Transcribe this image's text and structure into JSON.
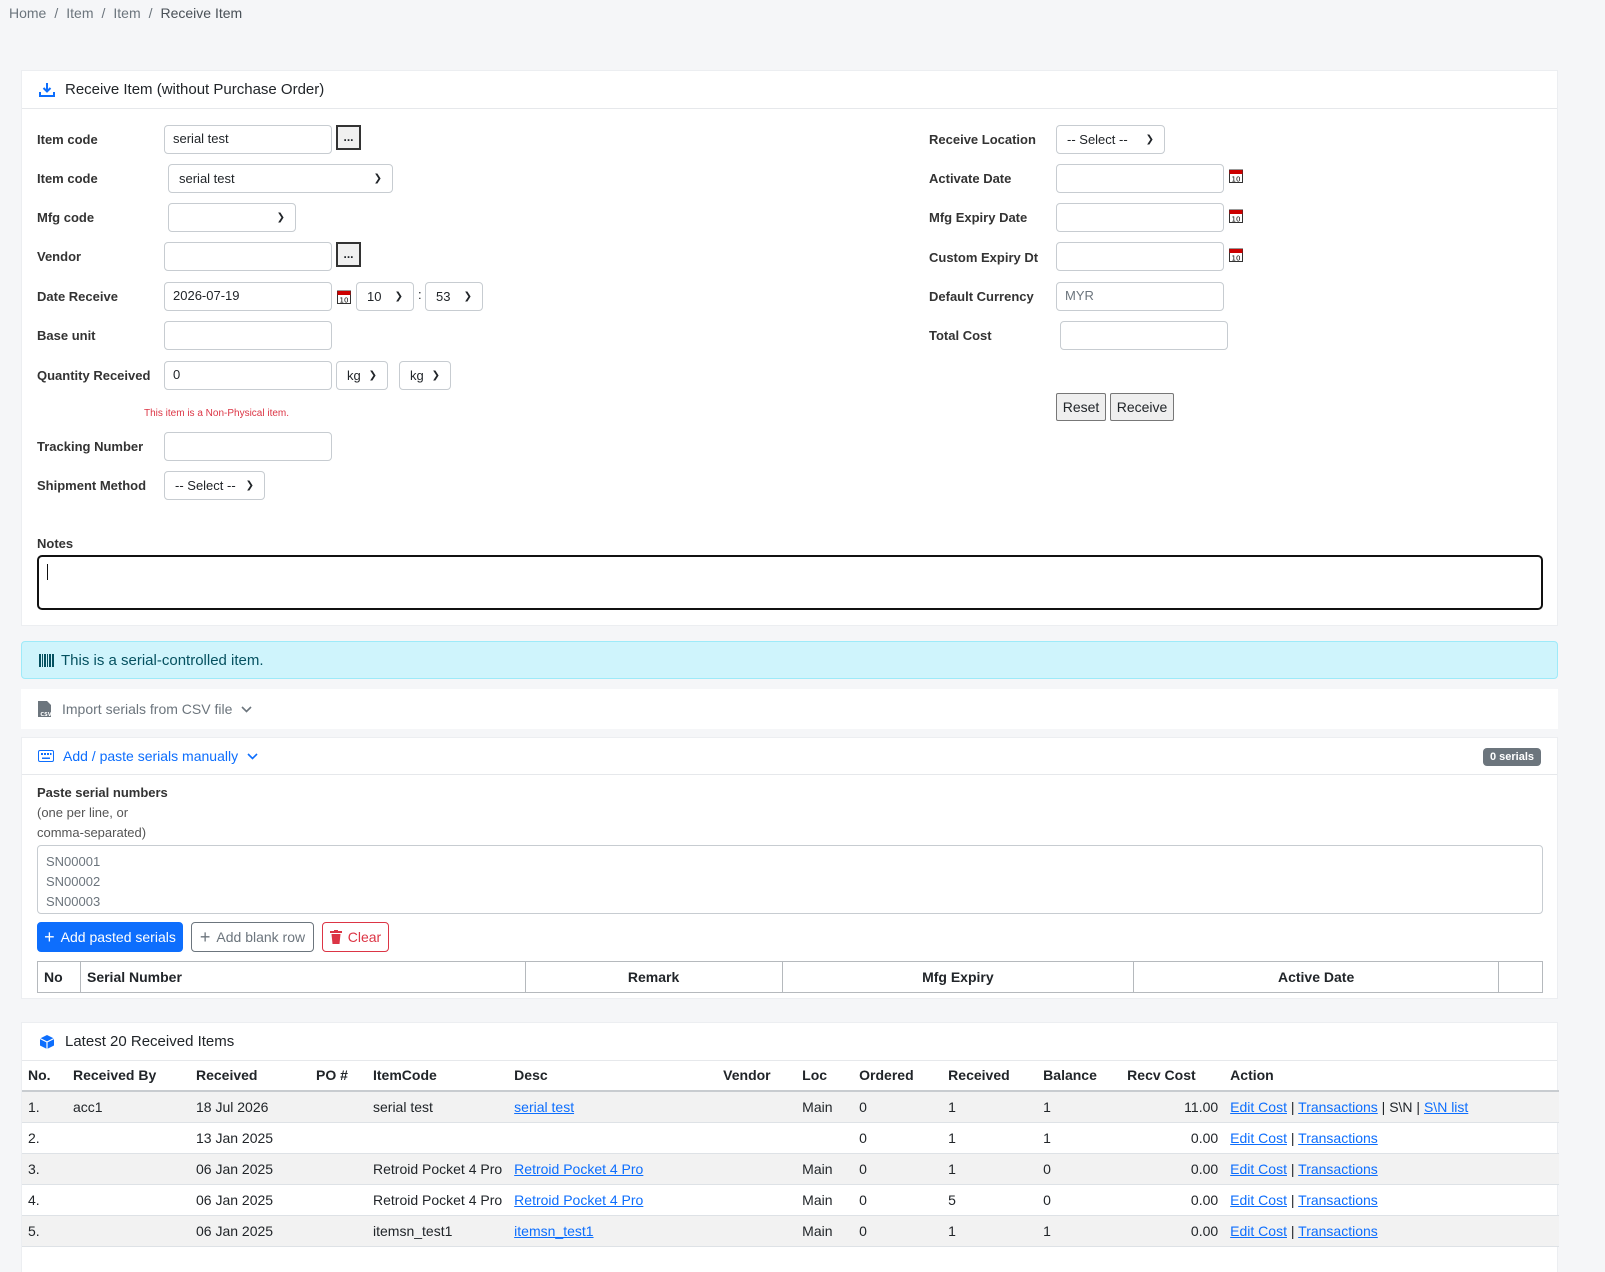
{
  "breadcrumb": {
    "home": "Home",
    "item1": "Item",
    "item2": "Item",
    "current": "Receive Item"
  },
  "receive_card": {
    "title": "Receive Item (without Purchase Order)",
    "item_code_label": "Item code",
    "item_code_value": "serial test",
    "item_code2_label": "Item code",
    "item_code2_value": "serial test",
    "mfg_code_label": "Mfg code",
    "vendor_label": "Vendor",
    "date_receive_label": "Date Receive",
    "date_receive_value": "2026-07-19",
    "hour": "10",
    "minute": "53",
    "time_sep": ":",
    "base_unit_label": "Base unit",
    "qty_label": "Quantity Received",
    "qty_value": "0",
    "unit1": "kg",
    "unit2": "kg",
    "non_physical_note": "This item is a Non-Physical item.",
    "tracking_label": "Tracking Number",
    "shipment_label": "Shipment Method",
    "shipment_value": "-- Select --",
    "receive_location_label": "Receive Location",
    "receive_location_value": "-- Select --",
    "activate_date_label": "Activate Date",
    "mfg_expiry_label": "Mfg Expiry Date",
    "custom_expiry_label": "Custom Expiry Dt",
    "default_currency_label": "Default Currency",
    "default_currency_placeholder": "MYR",
    "total_cost_label": "Total Cost",
    "reset_label": "Reset",
    "receive_label": "Receive",
    "notes_label": "Notes",
    "dots": "..."
  },
  "alert": {
    "text": "This is a serial-controlled item."
  },
  "import_csv": {
    "label": "Import serials from CSV file"
  },
  "manual": {
    "label": "Add / paste serials manually",
    "badge": "0 serials",
    "paste_label": "Paste serial numbers",
    "paste_hint_1": "(one per line, or",
    "paste_hint_2": "comma-separated)",
    "placeholder_line1": "SN00001",
    "placeholder_line2": "SN00002",
    "placeholder_line3": "SN00003",
    "add_pasted": "Add pasted serials",
    "add_blank": "Add blank row",
    "clear": "Clear",
    "columns": [
      "No",
      "Serial Number",
      "Remark",
      "Mfg Expiry",
      "Active Date"
    ]
  },
  "latest": {
    "title": "Latest 20 Received Items",
    "columns": [
      "No.",
      "Received By",
      "Received",
      "PO #",
      "ItemCode",
      "Desc",
      "Vendor",
      "Loc",
      "Ordered",
      "Received",
      "Balance",
      "Recv Cost",
      "Action"
    ],
    "rows": [
      {
        "no": "1.",
        "by": "acc1",
        "received": "18 Jul 2026",
        "po": "",
        "code": "serial test",
        "desc": "serial test",
        "vendor": "",
        "loc": "Main",
        "ordered": "0",
        "recv": "1",
        "balance": "1",
        "cost": "11.00",
        "edit": "Edit Cost",
        "trans": "Transactions",
        "sn": "S\\N",
        "snlist": "S\\N list"
      },
      {
        "no": "2.",
        "by": "",
        "received": "13 Jan 2025",
        "po": "",
        "code": "",
        "desc": "",
        "vendor": "",
        "loc": "",
        "ordered": "0",
        "recv": "1",
        "balance": "1",
        "cost": "0.00",
        "edit": "Edit Cost",
        "trans": "Transactions"
      },
      {
        "no": "3.",
        "by": "",
        "received": "06 Jan 2025",
        "po": "",
        "code": "Retroid Pocket 4 Pro",
        "desc": "Retroid Pocket 4 Pro",
        "vendor": "",
        "loc": "Main",
        "ordered": "0",
        "recv": "1",
        "balance": "0",
        "cost": "0.00",
        "edit": "Edit Cost",
        "trans": "Transactions"
      },
      {
        "no": "4.",
        "by": "",
        "received": "06 Jan 2025",
        "po": "",
        "code": "Retroid Pocket 4 Pro",
        "desc": "Retroid Pocket 4 Pro",
        "vendor": "",
        "loc": "Main",
        "ordered": "0",
        "recv": "5",
        "balance": "0",
        "cost": "0.00",
        "edit": "Edit Cost",
        "trans": "Transactions"
      },
      {
        "no": "5.",
        "by": "",
        "received": "06 Jan 2025",
        "po": "",
        "code": "itemsn_test1",
        "desc": "itemsn_test1",
        "vendor": "",
        "loc": "Main",
        "ordered": "0",
        "recv": "1",
        "balance": "1",
        "cost": "0.00",
        "edit": "Edit Cost",
        "trans": "Transactions"
      }
    ]
  },
  "colors": {
    "primary": "#0d6efd",
    "danger": "#dc3545",
    "alert_bg": "#cff4fc",
    "alert_text": "#055160",
    "note_red": "#dc3545"
  }
}
